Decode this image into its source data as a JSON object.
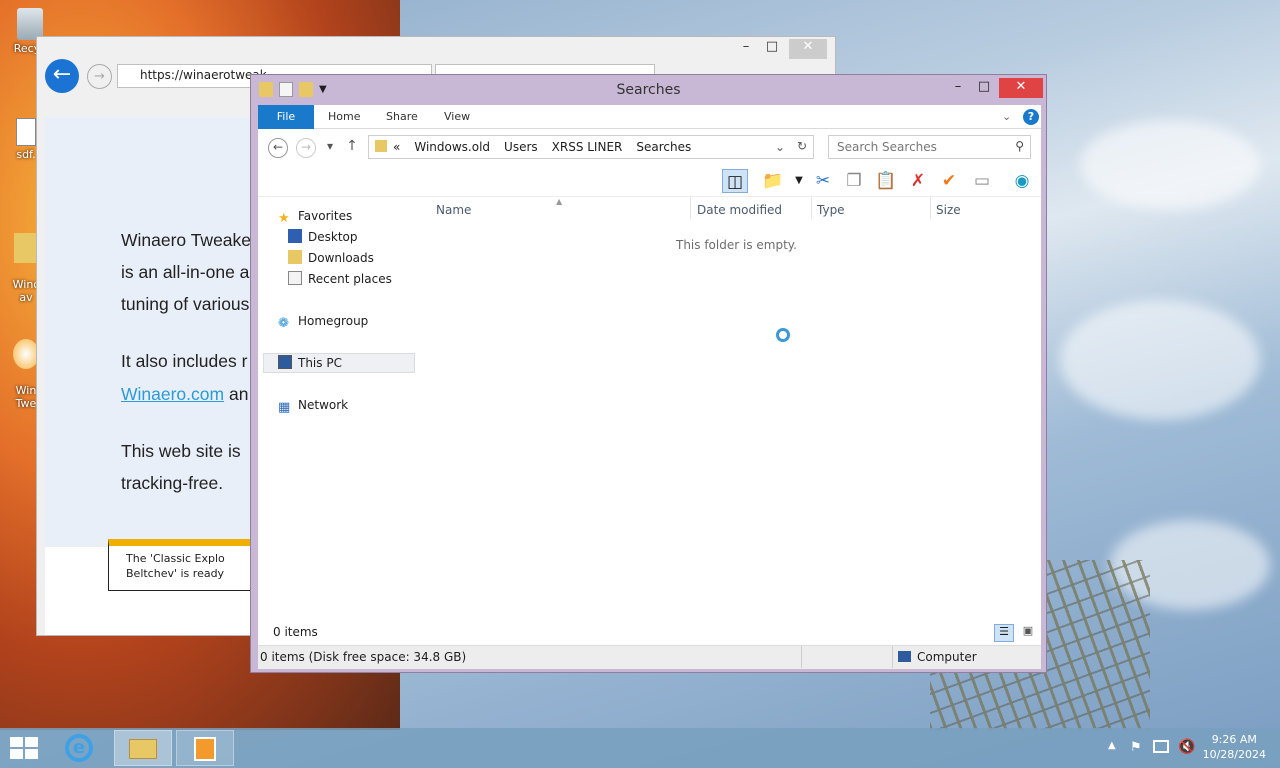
{
  "desktop": {
    "icons": [
      {
        "label": "Recyc",
        "icon": "recycle-bin-icon"
      },
      {
        "label": "sdf.",
        "icon": "text-file-icon"
      },
      {
        "label": "Winc\nav",
        "icon": "folder-icon"
      },
      {
        "label": "Win\nTwe",
        "icon": "app-icon"
      }
    ]
  },
  "ie": {
    "url": "https://winaerotweak",
    "content": {
      "line1": "Winaero Tweake",
      "line2": "is an all-in-one a",
      "line3": "tuning of various",
      "line4": "It also includes r",
      "link": "Winaero.com",
      "line5_suffix": " an",
      "line6": "This web site is",
      "line7": "tracking-free."
    },
    "toast": {
      "line1": "The 'Classic Explo",
      "line2": "Beltchev' is ready"
    }
  },
  "explorer": {
    "title": "Searches",
    "ribbon_tabs": [
      "File",
      "Home",
      "Share",
      "View"
    ],
    "breadcrumb": [
      "«",
      "Windows.old",
      "Users",
      "XRSS LINER",
      "Searches"
    ],
    "search_placeholder": "Search Searches",
    "nav": {
      "favorites": "Favorites",
      "desktop": "Desktop",
      "downloads": "Downloads",
      "recent": "Recent places",
      "homegroup": "Homegroup",
      "thispc": "This PC",
      "network": "Network"
    },
    "columns": [
      "Name",
      "Date modified",
      "Type",
      "Size"
    ],
    "empty_message": "This folder is empty.",
    "item_count": "0 items",
    "status": "0 items (Disk free space: 34.8 GB)",
    "location": "Computer"
  },
  "taskbar": {
    "time": "9:26 AM",
    "date": "10/28/2024"
  },
  "colors": {
    "accent": "#1979ca",
    "close": "#e04343"
  }
}
